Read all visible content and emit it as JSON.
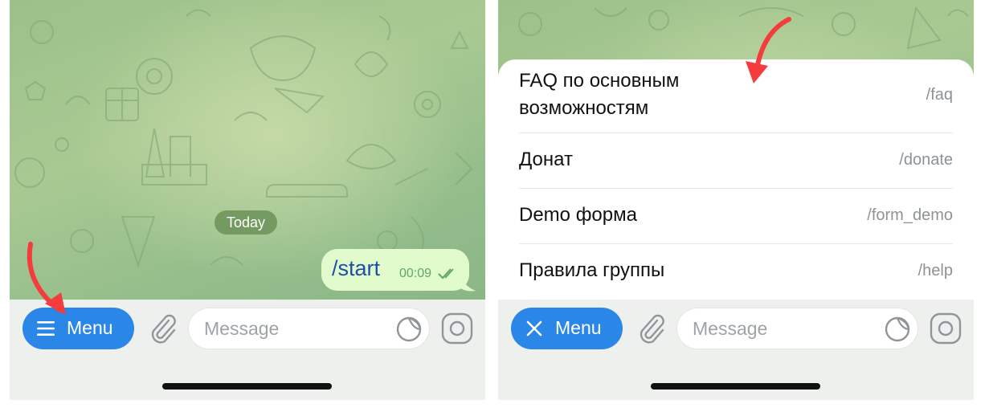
{
  "left_screen": {
    "date_label": "Today",
    "message": {
      "text": "/start",
      "time": "00:09",
      "status_icon": "double-check-icon"
    },
    "menu_button": {
      "label": "Menu",
      "icon": "hamburger-icon"
    },
    "attach_icon": "paperclip-icon",
    "input": {
      "placeholder": "Message",
      "value": ""
    },
    "sticker_icon": "sticker-icon",
    "camera_icon": "camera-icon",
    "annotation_arrow_color": "#f43c3c"
  },
  "right_screen": {
    "commands": [
      {
        "title": "FAQ по основным возможностям",
        "command": "/faq"
      },
      {
        "title": "Донат",
        "command": "/donate"
      },
      {
        "title": "Demo форма",
        "command": "/form_demo"
      },
      {
        "title": "Правила группы",
        "command": "/help"
      }
    ],
    "menu_button": {
      "label": "Menu",
      "icon": "close-icon"
    },
    "attach_icon": "paperclip-icon",
    "input": {
      "placeholder": "Message",
      "value": ""
    },
    "sticker_icon": "sticker-icon",
    "camera_icon": "camera-icon",
    "annotation_arrow_color": "#f43c3c"
  },
  "colors": {
    "accent": "#2a87e8",
    "bubble": "#e2fbcd",
    "chat_background": "#a9c992"
  }
}
